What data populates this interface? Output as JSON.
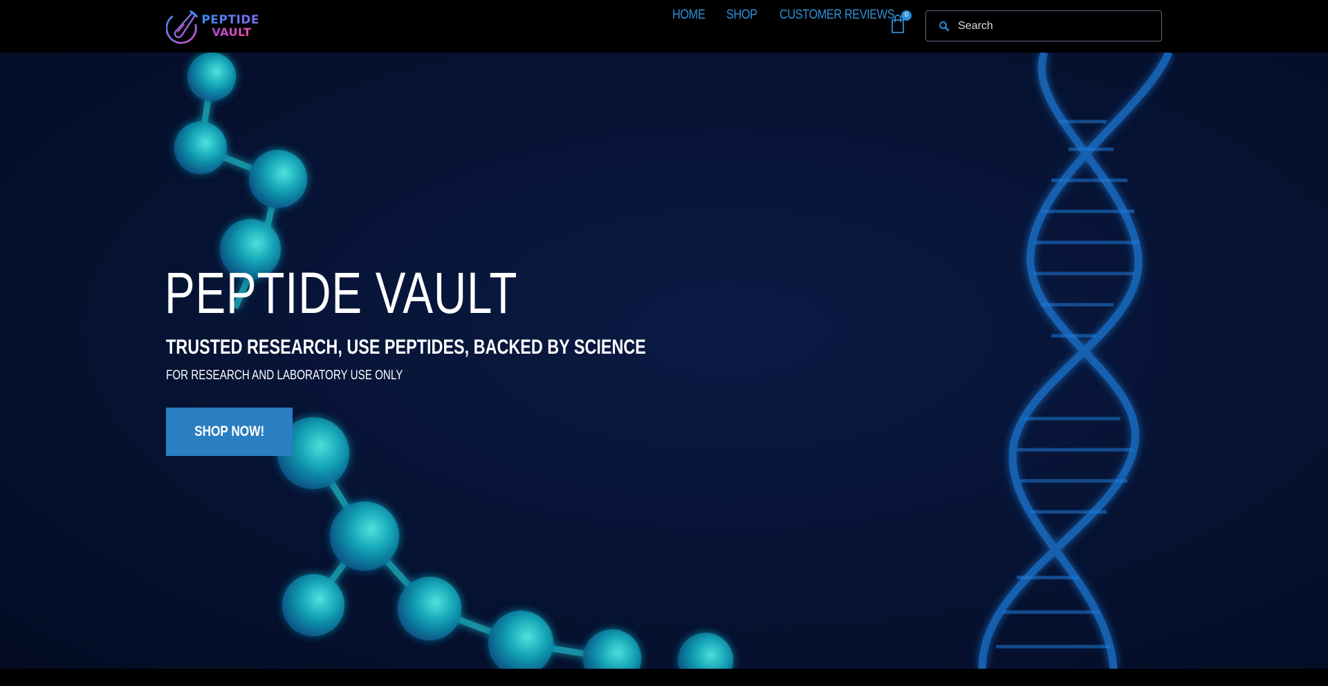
{
  "brand": {
    "logo_line1": "PEPTIDE",
    "logo_line2": "VAULT",
    "logo_icon": "test-tube-icon"
  },
  "nav": {
    "items": [
      {
        "label": "HOME"
      },
      {
        "label": "SHOP"
      },
      {
        "label": "CUSTOMER REVIEWS"
      }
    ],
    "cart": {
      "icon": "shopping-bag-icon",
      "count": "0"
    }
  },
  "search": {
    "placeholder": "Search",
    "value": "",
    "icon": "search-icon"
  },
  "hero": {
    "title": "PEPTIDE VAULT",
    "subtitle": "TRUSTED RESEARCH, USE PEPTIDES, BACKED BY SCIENCE",
    "note": "FOR RESEARCH AND LABORATORY USE ONLY",
    "cta_label": "SHOP NOW!"
  },
  "colors": {
    "accent": "#2e8fd6",
    "button": "#2a7ec2",
    "header_bg": "#000000",
    "hero_bg": "#071436",
    "molecule": "#1fb7c8",
    "dna": "#1e78d8"
  }
}
